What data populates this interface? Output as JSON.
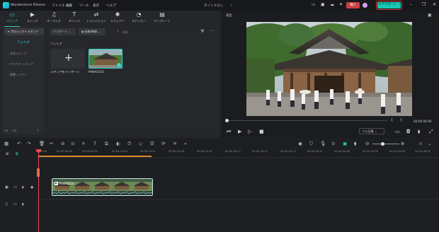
{
  "app": {
    "title": "Wondershare Filmora",
    "project_title": "タイトルなし",
    "menu": [
      "ファイル",
      "編集",
      "ツール",
      "表示",
      "ヘルプ"
    ],
    "purchase_label": "購入",
    "export_label": "エクスポート"
  },
  "media_tabs": [
    {
      "label": "メディア",
      "icon": "folder-icon",
      "active": true
    },
    {
      "label": "ストック",
      "icon": "stock-icon",
      "active": false
    },
    {
      "label": "オーディオ",
      "icon": "music-icon",
      "active": false
    },
    {
      "label": "タイトル",
      "icon": "text-icon",
      "active": false
    },
    {
      "label": "トランジション",
      "icon": "transition-icon",
      "active": false
    },
    {
      "label": "エフェクト",
      "icon": "effect-icon",
      "active": false
    },
    {
      "label": "ステッカー",
      "icon": "sticker-icon",
      "active": false
    },
    {
      "label": "テンプレート",
      "icon": "template-icon",
      "active": false
    }
  ],
  "sidebar": {
    "header": "プロジェクトメディア",
    "folder_label": "フォルダ",
    "items": [
      "共有メディア",
      "クラウド メディア",
      "調整レイヤー"
    ]
  },
  "library": {
    "import_label": "インポート",
    "filter_label": "画像/映像",
    "search_placeholder": "検索",
    "section_label": "フォルダ",
    "import_card_label": "メディアをインポート",
    "clip_label": "PANA0210"
  },
  "player": {
    "label": "再生",
    "timecode": "00:00:00:00",
    "quality": "フル品質",
    "bracket_in": "{",
    "bracket_out": "}"
  },
  "timeline": {
    "ticks": [
      "00:00",
      "00:00:04:55",
      "00:00:09:50",
      "00:00:14:45",
      "00:00:19:41",
      "00:00:24:36",
      "00:00:29:31",
      "00:00:34:27",
      "00:00:39:22",
      "00:00:44:17",
      "00:00:49:12",
      "00:00:54:08",
      "00:00:59:03",
      "00:01:03:58",
      "00:01:08:53"
    ],
    "clip_label": "PANA0210"
  },
  "colors": {
    "accent": "#27d4c4",
    "export_border": "#e8322f",
    "playhead": "#e64a4a",
    "purchase": "#c9403e"
  }
}
